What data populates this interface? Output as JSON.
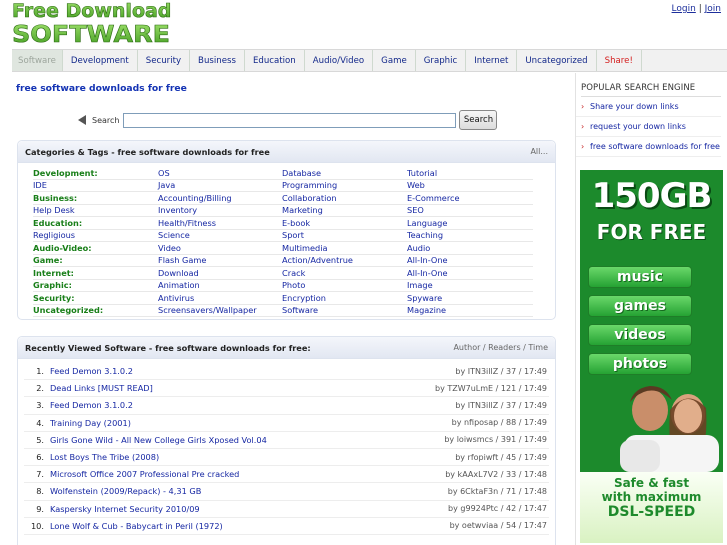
{
  "header": {
    "logo_line1": "Free Download",
    "logo_line2": "SOFTWARE",
    "login_label": "Login",
    "separator": "|",
    "join_label": "Join"
  },
  "nav": {
    "items": [
      {
        "label": "Software",
        "active": true
      },
      {
        "label": "Development"
      },
      {
        "label": "Security"
      },
      {
        "label": "Business"
      },
      {
        "label": "Education"
      },
      {
        "label": "Audio/Video"
      },
      {
        "label": "Game"
      },
      {
        "label": "Graphic"
      },
      {
        "label": "Internet"
      },
      {
        "label": "Uncategorized"
      },
      {
        "label": "Share!"
      }
    ]
  },
  "main": {
    "page_title": "free software downloads for free",
    "search": {
      "label": "Search",
      "value": "",
      "button_label": "Search"
    },
    "categories": {
      "title": "Categories & Tags - free software downloads for free",
      "all_link": "All...",
      "rows": [
        [
          "Development:",
          "OS",
          "Database",
          "Tutorial"
        ],
        [
          "IDE",
          "Java",
          "Programming",
          "Web"
        ],
        [
          "Business:",
          "Accounting/Billing",
          "Collaboration",
          "E-Commerce"
        ],
        [
          "Help Desk",
          "Inventory",
          "Marketing",
          "SEO"
        ],
        [
          "Education:",
          "Health/Fitness",
          "E-book",
          "Language"
        ],
        [
          "Regligious",
          "Science",
          "Sport",
          "Teaching"
        ],
        [
          "Audio-Video:",
          "Video",
          "Multimedia",
          "Audio"
        ],
        [
          "Game:",
          "Flash Game",
          "Action/Adventrue",
          "All-In-One"
        ],
        [
          "Internet:",
          "Download",
          "Crack",
          "All-In-One"
        ],
        [
          "Graphic:",
          "Animation",
          "Photo",
          "Image"
        ],
        [
          "Security:",
          "Antivirus",
          "Encryption",
          "Spyware"
        ],
        [
          "Uncategorized:",
          "Screensavers/Wallpaper",
          "Software",
          "Magazine"
        ]
      ]
    },
    "recent": {
      "title": "Recently Viewed Software - free software downloads for free:",
      "columns_label": "Author / Readers / Time",
      "items": [
        {
          "num": "1.",
          "title": "Feed Demon 3.1.0.2",
          "meta": "by ITN3illZ / 37 / 17:49"
        },
        {
          "num": "2.",
          "title": "Dead Links [MUST READ]",
          "meta": "by TZW7uLmE / 121 / 17:49"
        },
        {
          "num": "3.",
          "title": "Feed Demon 3.1.0.2",
          "meta": "by ITN3illZ / 37 / 17:49"
        },
        {
          "num": "4.",
          "title": "Training Day (2001)",
          "meta": "by nfiposap / 88 / 17:49"
        },
        {
          "num": "5.",
          "title": "Girls Gone Wild - All New College Girls Xposed Vol.04",
          "meta": "by loiwsmcs / 391 / 17:49"
        },
        {
          "num": "6.",
          "title": "Lost Boys The Tribe (2008)",
          "meta": "by rfopiwft / 45 / 17:49"
        },
        {
          "num": "7.",
          "title": "Microsoft Office 2007 Professional Pre cracked",
          "meta": "by kAAxL7V2 / 33 / 17:48"
        },
        {
          "num": "8.",
          "title": "Wolfenstein (2009/Repack) - 4,31 GB",
          "meta": "by 6CktaF3n / 71 / 17:48"
        },
        {
          "num": "9.",
          "title": "Kaspersky Internet Security 2010/09",
          "meta": "by g9924Ptc / 42 / 17:47"
        },
        {
          "num": "10.",
          "title": "Lone Wolf & Cub - Babycart in Peril (1972)",
          "meta": "by oetwviaa / 54 / 17:47"
        }
      ]
    }
  },
  "sidebar": {
    "title": "POPULAR SEARCH ENGINE",
    "items": [
      {
        "label": "Share your down links"
      },
      {
        "label": "request your down links"
      },
      {
        "label": "free software downloads for free"
      }
    ],
    "ad": {
      "headline": "150GB",
      "subheadline": "FOR FREE",
      "buttons": [
        "music",
        "games",
        "videos",
        "photos"
      ],
      "tagline_1": "Safe & fast",
      "tagline_2": "with maximum",
      "tagline_3": "DSL-SPEED"
    }
  },
  "colors": {
    "link": "#1627a3",
    "category_head": "#197f19",
    "share": "#d42020",
    "ad_green": "#1c8a2c"
  }
}
